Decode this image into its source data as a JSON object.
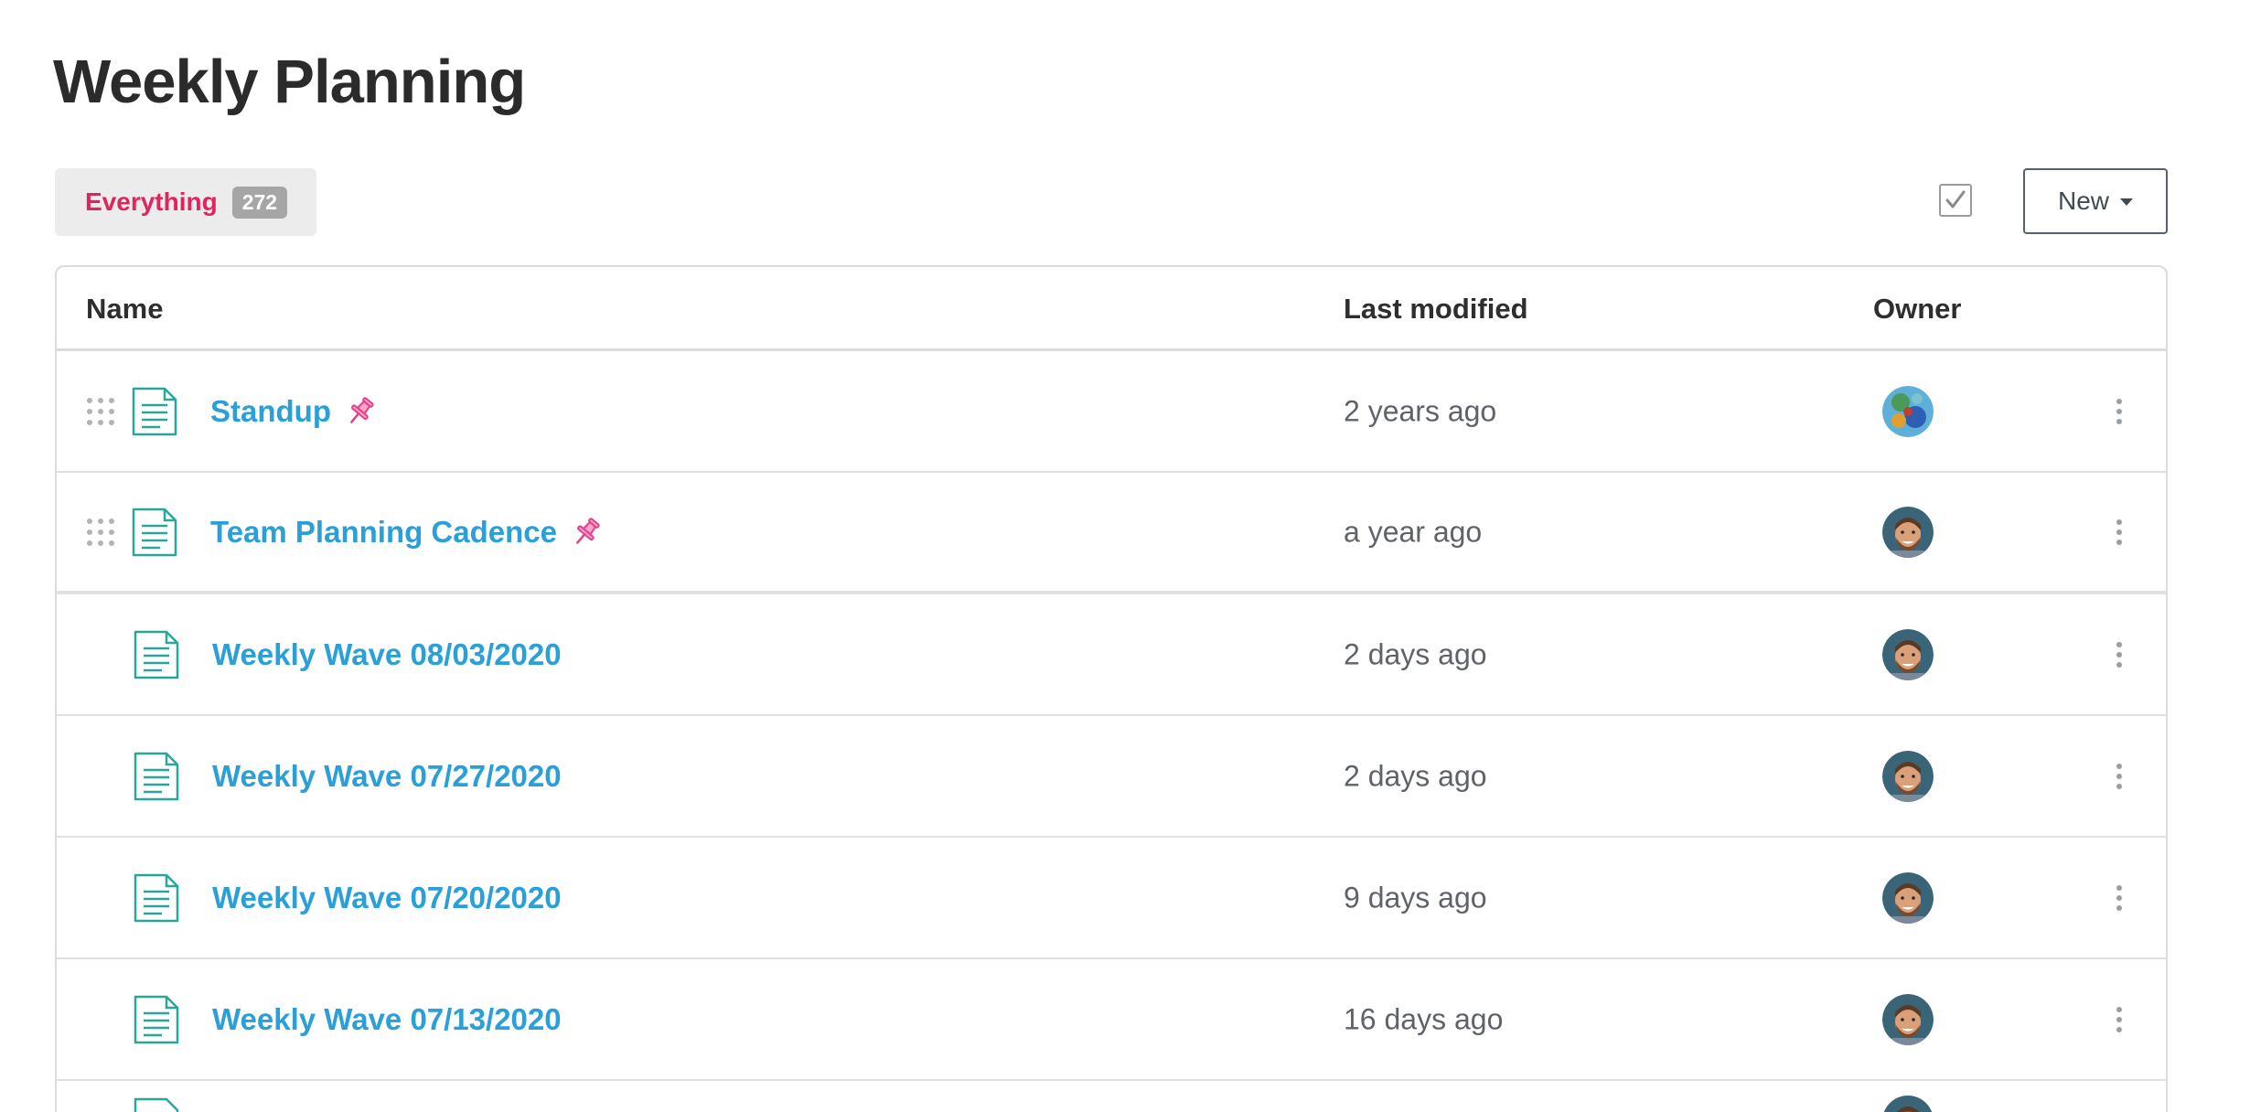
{
  "page": {
    "title": "Weekly Planning"
  },
  "filter": {
    "label": "Everything",
    "count": "272"
  },
  "toolbar": {
    "new_label": "New"
  },
  "table": {
    "columns": {
      "name": "Name",
      "modified": "Last modified",
      "owner": "Owner"
    },
    "rows": [
      {
        "name": "Standup",
        "modified": "2 years ago",
        "pinned": true,
        "owner_avatar": "avatar-coral"
      },
      {
        "name": "Team Planning Cadence",
        "modified": "a year ago",
        "pinned": true,
        "owner_avatar": "avatar-man"
      },
      {
        "name": "Weekly Wave 08/03/2020",
        "modified": "2 days ago",
        "pinned": false,
        "owner_avatar": "avatar-man"
      },
      {
        "name": "Weekly Wave 07/27/2020",
        "modified": "2 days ago",
        "pinned": false,
        "owner_avatar": "avatar-man"
      },
      {
        "name": "Weekly Wave 07/20/2020",
        "modified": "9 days ago",
        "pinned": false,
        "owner_avatar": "avatar-man"
      },
      {
        "name": "Weekly Wave 07/13/2020",
        "modified": "16 days ago",
        "pinned": false,
        "owner_avatar": "avatar-man"
      }
    ]
  },
  "colors": {
    "link": "#2a9fd8",
    "accent": "#e0245e",
    "pin": "#e83e8c",
    "doc_icon": "#2aa59a"
  }
}
